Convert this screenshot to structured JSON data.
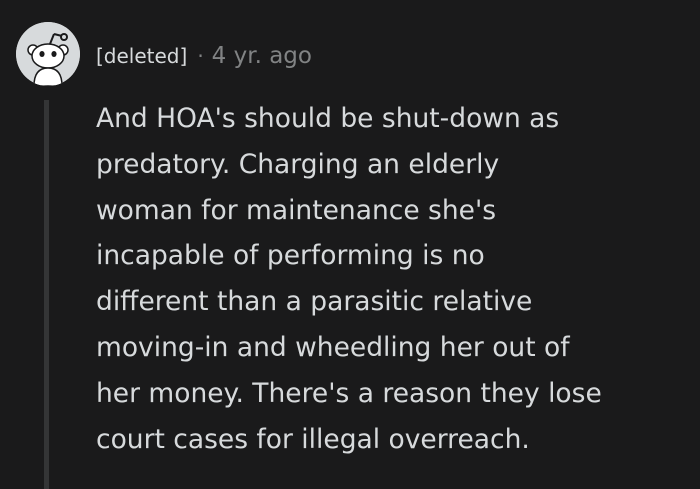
{
  "comment": {
    "avatar_icon": "reddit-snoo-avatar-icon",
    "author": "[deleted]",
    "separator": "·",
    "timestamp": "4 yr. ago",
    "body_lines": [
      "And HOA's should be shut-down as",
      "predatory. Charging an elderly",
      "woman for maintenance she's",
      "incapable of performing is no",
      "different than a parasitic relative",
      "moving-in and wheedling her out of",
      "her money. There's a reason they lose",
      "court cases for illegal overreach."
    ]
  },
  "colors": {
    "background": "#1a1a1b",
    "text": "#d7dadc",
    "muted": "#818384",
    "thread_line": "#343536",
    "avatar_bg": "#d7dadc"
  }
}
